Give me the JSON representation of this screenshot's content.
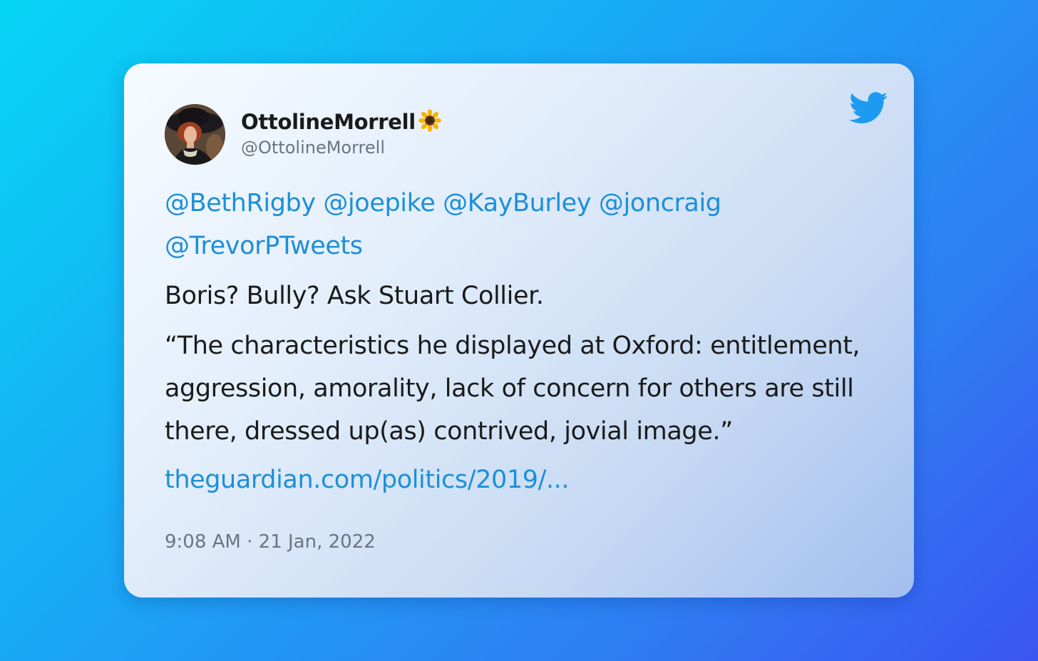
{
  "author": {
    "display_name": "OttolineMorrell",
    "handle": "@OttolineMorrell",
    "name_emoji": "sunflower-icon"
  },
  "tweet": {
    "mentions": [
      "@BethRigby",
      "@joepike",
      "@KayBurley",
      "@joncraig",
      "@TrevorPTweets"
    ],
    "line1": "Boris? Bully? Ask Stuart Collier.",
    "quote": "“The characteristics he displayed at Oxford: entitlement, aggression, amorality, lack of concern for others are still there, dressed up(as) contrived, jovial image.”",
    "link": "theguardian.com/politics/2019/...",
    "timestamp": "9:08 AM · 21 Jan, 2022"
  },
  "colors": {
    "link": "#1d8fd6",
    "twitter_blue": "#1d9bf0",
    "text": "#1a1a1a",
    "muted": "#6b7580"
  }
}
